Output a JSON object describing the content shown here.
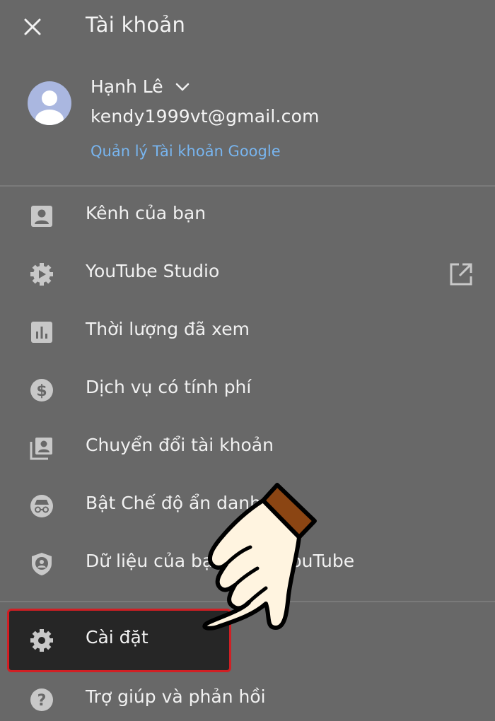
{
  "header": {
    "close_icon": "close-icon",
    "title": "Tài khoản"
  },
  "account": {
    "avatar_icon": "default-avatar-icon",
    "name": "Hạnh Lê",
    "email": "kendy1999vt@gmail.com",
    "manage_link": "Quản lý Tài khoản Google",
    "manage_color": "#78b5ef"
  },
  "menu": {
    "items": [
      {
        "icon": "person-box-icon",
        "label": "Kênh của bạn"
      },
      {
        "icon": "studio-gear-play-icon",
        "label": "YouTube Studio",
        "trailing_icon": "open-external-icon"
      },
      {
        "icon": "bar-chart-icon",
        "label": "Thời lượng đã xem"
      },
      {
        "icon": "dollar-circle-icon",
        "label": "Dịch vụ có tính phí"
      },
      {
        "icon": "switch-account-icon",
        "label": "Chuyển đổi tài khoản"
      },
      {
        "icon": "incognito-icon",
        "label": "Bật Chế độ ẩn danh"
      },
      {
        "icon": "shield-person-icon",
        "label": "Dữ liệu của bạn trong YouTube"
      }
    ],
    "settings": {
      "icon": "gear-icon",
      "label": "Cài đặt"
    },
    "help": {
      "icon": "help-circle-icon",
      "label": "Trợ giúp và phản hồi"
    }
  },
  "colors": {
    "background": "#686868",
    "highlight_border": "#d11f24",
    "highlight_bg": "#262626",
    "icon": "#c8c8c8"
  },
  "overlay": {
    "pointer_icon": "pointing-hand-icon"
  }
}
